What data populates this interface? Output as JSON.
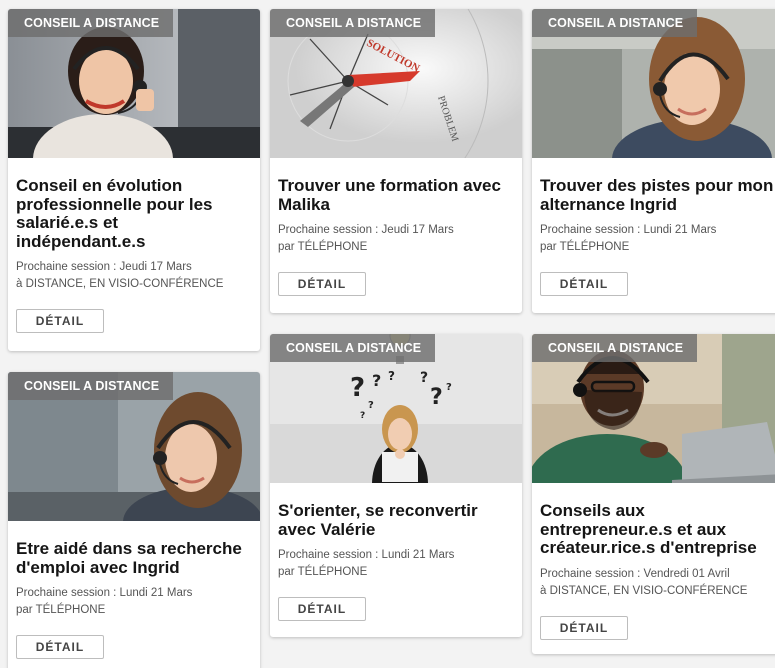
{
  "cards": [
    {
      "badge": "CONSEIL A DISTANCE",
      "title": "Conseil en évolution professionnelle pour les salarié.e.s et indépendant.e.s",
      "session": "Prochaine session : Jeudi 17 Mars",
      "mode": "à DISTANCE, EN VISIO-CONFÉRENCE",
      "button": "DÉTAIL"
    },
    {
      "badge": "CONSEIL A DISTANCE",
      "title": "Trouver une formation avec Malika",
      "session": "Prochaine session : Jeudi 17 Mars",
      "mode": "par TÉLÉPHONE",
      "button": "DÉTAIL",
      "image_text": [
        "SOLUTION",
        "PROBLEM"
      ]
    },
    {
      "badge": "CONSEIL A DISTANCE",
      "title": "Trouver des pistes pour mon alternance Ingrid",
      "session": "Prochaine session : Lundi 21 Mars",
      "mode": "par TÉLÉPHONE",
      "button": "DÉTAIL"
    },
    {
      "badge": "CONSEIL A DISTANCE",
      "title": "Etre aidé dans sa recherche d'emploi avec Ingrid",
      "session": "Prochaine session : Lundi 21 Mars",
      "mode": "par TÉLÉPHONE",
      "button": "DÉTAIL"
    },
    {
      "badge": "CONSEIL A DISTANCE",
      "title": "S'orienter, se reconvertir avec Valérie",
      "session": "Prochaine session : Lundi 21 Mars",
      "mode": "par TÉLÉPHONE",
      "button": "DÉTAIL"
    },
    {
      "badge": "CONSEIL A DISTANCE",
      "title": "Conseils aux entrepreneur.e.s et aux créateur.rice.s d'entreprise",
      "session": "Prochaine session : Vendredi 01 Avril",
      "mode": "à DISTANCE, EN VISIO-CONFÉRENCE",
      "button": "DÉTAIL"
    }
  ]
}
